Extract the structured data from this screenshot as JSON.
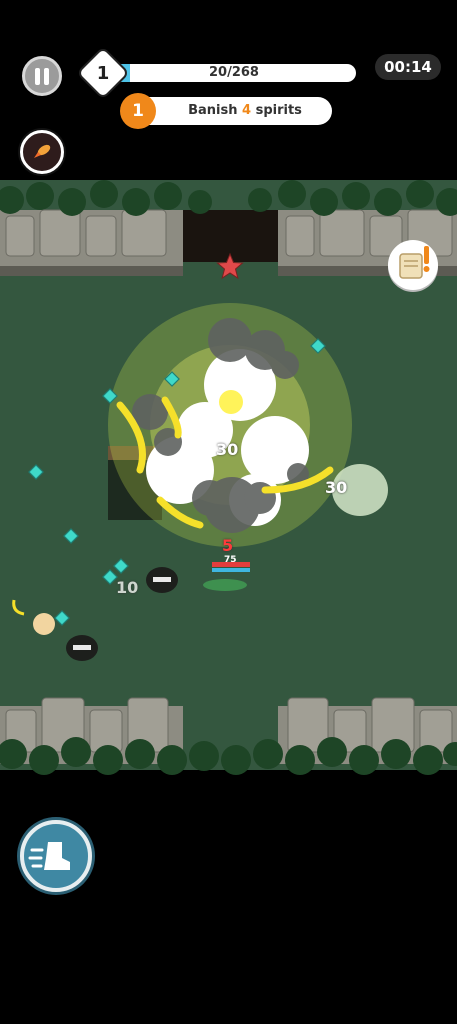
{
  "hud": {
    "level": "1",
    "xp_text": "20/268",
    "xp_fraction": 0.075,
    "timer": "00:14"
  },
  "quest": {
    "step": "1",
    "text_prefix": "Banish",
    "count": "4",
    "text_suffix": "spirits"
  },
  "combat": {
    "damage_numbers": [
      "30",
      "30",
      "10",
      "5"
    ],
    "player_hp": "75"
  },
  "colors": {
    "xp_fill": "#4fc3e8",
    "quest_accent": "#f0881a",
    "grass": "#34573f"
  },
  "icons": [
    "pause-icon",
    "rocket-skill-icon",
    "star-marker-icon",
    "scroll-quest-icon",
    "dash-boot-icon"
  ]
}
